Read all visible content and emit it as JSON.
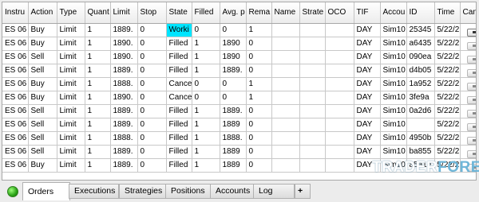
{
  "columns": [
    "Instru",
    "Action",
    "Type",
    "Quant",
    "Limit",
    "Stop",
    "State",
    "Filled",
    "Avg. p",
    "Rema",
    "Name",
    "Strate",
    "OCO",
    "TIF",
    "Accou",
    "ID",
    "Time",
    "Cance"
  ],
  "rows": [
    {
      "cells": [
        "ES 06",
        "Buy",
        "Limit",
        "1",
        "1889.",
        "0",
        "Worki",
        "0",
        "0",
        "1",
        "",
        "",
        "",
        "DAY",
        "Sim10",
        "25345",
        "5/22/2"
      ],
      "highlight": 6,
      "cancel": "dark"
    },
    {
      "cells": [
        "ES 06",
        "Buy",
        "Limit",
        "1",
        "1890.",
        "0",
        "Filled",
        "1",
        "1890",
        "0",
        "",
        "",
        "",
        "DAY",
        "Sim10",
        "a6435",
        "5/22/2"
      ],
      "highlight": -1,
      "cancel": "light"
    },
    {
      "cells": [
        "ES 06",
        "Sell",
        "Limit",
        "1",
        "1890.",
        "0",
        "Filled",
        "1",
        "1890",
        "0",
        "",
        "",
        "",
        "DAY",
        "Sim10",
        "090ea",
        "5/22/2"
      ],
      "highlight": -1,
      "cancel": "light"
    },
    {
      "cells": [
        "ES 06",
        "Sell",
        "Limit",
        "1",
        "1889.",
        "0",
        "Filled",
        "1",
        "1889.",
        "0",
        "",
        "",
        "",
        "DAY",
        "Sim10",
        "d4b05",
        "5/22/2"
      ],
      "highlight": -1,
      "cancel": "light"
    },
    {
      "cells": [
        "ES 06",
        "Buy",
        "Limit",
        "1",
        "1888.",
        "0",
        "Cance",
        "0",
        "0",
        "1",
        "",
        "",
        "",
        "DAY",
        "Sim10",
        "1a952",
        "5/22/2"
      ],
      "highlight": -1,
      "cancel": "light"
    },
    {
      "cells": [
        "ES 06",
        "Buy",
        "Limit",
        "1",
        "1890.",
        "0",
        "Cance",
        "0",
        "0",
        "1",
        "",
        "",
        "",
        "DAY",
        "Sim10",
        "3fe9a",
        "5/22/2"
      ],
      "highlight": -1,
      "cancel": "light"
    },
    {
      "cells": [
        "ES 06",
        "Sell",
        "Limit",
        "1",
        "1889.",
        "0",
        "Filled",
        "1",
        "1889.",
        "0",
        "",
        "",
        "",
        "DAY",
        "Sim10",
        "0a2d6",
        "5/22/2"
      ],
      "highlight": -1,
      "cancel": "light"
    },
    {
      "cells": [
        "ES 06",
        "Sell",
        "Limit",
        "1",
        "1889.",
        "0",
        "Filled",
        "1",
        "1889",
        "0",
        "",
        "",
        "",
        "DAY",
        "Sim10",
        "",
        "5/22/2"
      ],
      "highlight": -1,
      "cancel": "light"
    },
    {
      "cells": [
        "ES 06",
        "Sell",
        "Limit",
        "1",
        "1888.",
        "0",
        "Filled",
        "1",
        "1888.",
        "0",
        "",
        "",
        "",
        "DAY",
        "Sim10",
        "4950b",
        "5/22/2"
      ],
      "highlight": -1,
      "cancel": "light"
    },
    {
      "cells": [
        "ES 06",
        "Sell",
        "Limit",
        "1",
        "1889.",
        "0",
        "Filled",
        "1",
        "1889",
        "0",
        "",
        "",
        "",
        "DAY",
        "Sim10",
        "ba855",
        "5/22/2"
      ],
      "highlight": -1,
      "cancel": "light"
    },
    {
      "cells": [
        "ES 06",
        "Buy",
        "Limit",
        "1",
        "1889.",
        "0",
        "Filled",
        "1",
        "1889",
        "0",
        "",
        "",
        "",
        "DAY",
        "Sim10",
        "a5a1e",
        "5/22/2"
      ],
      "highlight": -1,
      "cancel": "light"
    }
  ],
  "tabs": [
    "Orders",
    "Executions",
    "Strategies",
    "Positions",
    "Accounts",
    "Log",
    "+"
  ],
  "active_tab": 0,
  "watermark": {
    "main": "TRADER",
    "accent": "FOREX"
  },
  "colors": {
    "working_state": "#00e5ff",
    "status_dot": "#2aa316",
    "header_bg": "#f4f4f4",
    "grid_bg": "#ffffff"
  }
}
